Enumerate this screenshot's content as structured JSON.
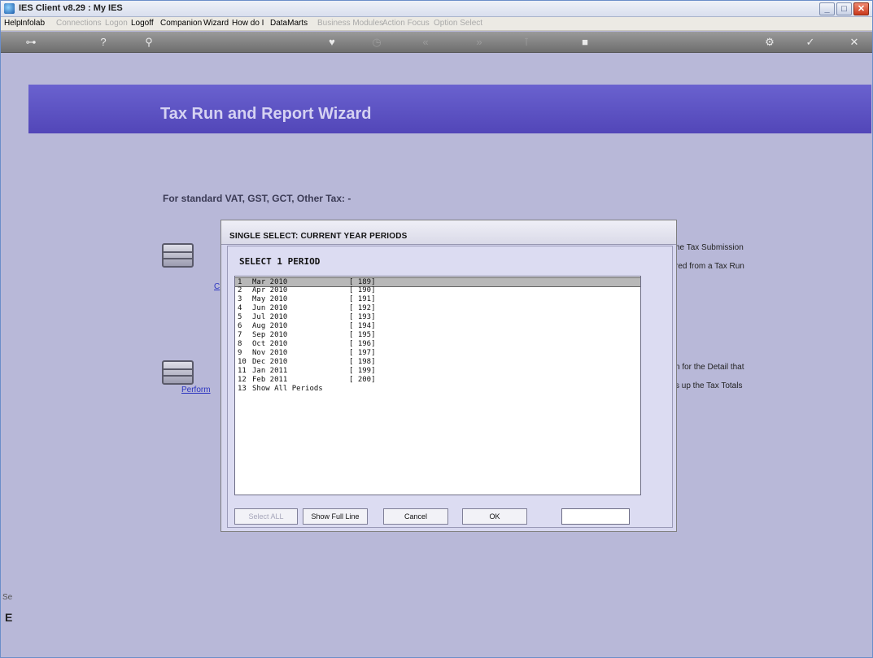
{
  "window": {
    "title": "IES Client v8.29 : My IES",
    "controls": [
      "minimize-icon",
      "maximize-icon",
      "close-icon"
    ]
  },
  "menu": [
    {
      "label": "Help",
      "enabled": true
    },
    {
      "label": "Infolab",
      "enabled": true
    },
    {
      "label": "Connections",
      "enabled": false
    },
    {
      "label": "Logon",
      "enabled": false
    },
    {
      "label": "Logoff",
      "enabled": true
    },
    {
      "label": "Companion",
      "enabled": true
    },
    {
      "label": "Wizard",
      "enabled": true
    },
    {
      "label": "How do I",
      "enabled": true
    },
    {
      "label": "DataMarts",
      "enabled": true
    },
    {
      "label": "Business Modules",
      "enabled": false
    },
    {
      "label": "Action Focus",
      "enabled": false
    },
    {
      "label": "Option Select",
      "enabled": false
    }
  ],
  "toolbar_icons": [
    "key-icon",
    "help-icon",
    "search-icon",
    "heart-icon",
    "clock-icon",
    "rewind-icon",
    "fast-forward-icon",
    "pin-icon",
    "stop-icon",
    "gear-icon",
    "check-icon",
    "close-icon"
  ],
  "banner": {
    "title": "Tax Run and Report Wizard"
  },
  "main": {
    "section_label": "For standard VAT, GST, GCT, Other Tax: -",
    "link_1": "C",
    "link_2": "Perform",
    "text_1a": "he Tax Submission",
    "text_1b": "red from a Tax Run",
    "text_2a": "n for the Detail that",
    "text_2b": "s up the Tax Totals",
    "bottom_cut": "Se",
    "bottom_e": "E"
  },
  "dialog": {
    "title": "SINGLE SELECT: CURRENT YEAR PERIODS",
    "header": "SELECT 1 PERIOD",
    "selected_index": 0,
    "items": [
      {
        "num": "1",
        "period": "Mar 2010",
        "code": "[ 189]"
      },
      {
        "num": "2",
        "period": "Apr 2010",
        "code": "[ 190]"
      },
      {
        "num": "3",
        "period": "May 2010",
        "code": "[ 191]"
      },
      {
        "num": "4",
        "period": "Jun 2010",
        "code": "[ 192]"
      },
      {
        "num": "5",
        "period": "Jul 2010",
        "code": "[ 193]"
      },
      {
        "num": "6",
        "period": "Aug 2010",
        "code": "[ 194]"
      },
      {
        "num": "7",
        "period": "Sep 2010",
        "code": "[ 195]"
      },
      {
        "num": "8",
        "period": "Oct 2010",
        "code": "[ 196]"
      },
      {
        "num": "9",
        "period": "Nov 2010",
        "code": "[ 197]"
      },
      {
        "num": "10",
        "period": "Dec 2010",
        "code": "[ 198]"
      },
      {
        "num": "11",
        "period": "Jan 2011",
        "code": "[ 199]"
      },
      {
        "num": "12",
        "period": "Feb 2011",
        "code": "[ 200]"
      },
      {
        "num": "13",
        "period": "Show All Periods",
        "code": ""
      }
    ],
    "buttons": {
      "select_all": "Select ALL",
      "show_full_line": "Show Full Line",
      "cancel": "Cancel",
      "ok": "OK"
    },
    "input_value": ""
  }
}
